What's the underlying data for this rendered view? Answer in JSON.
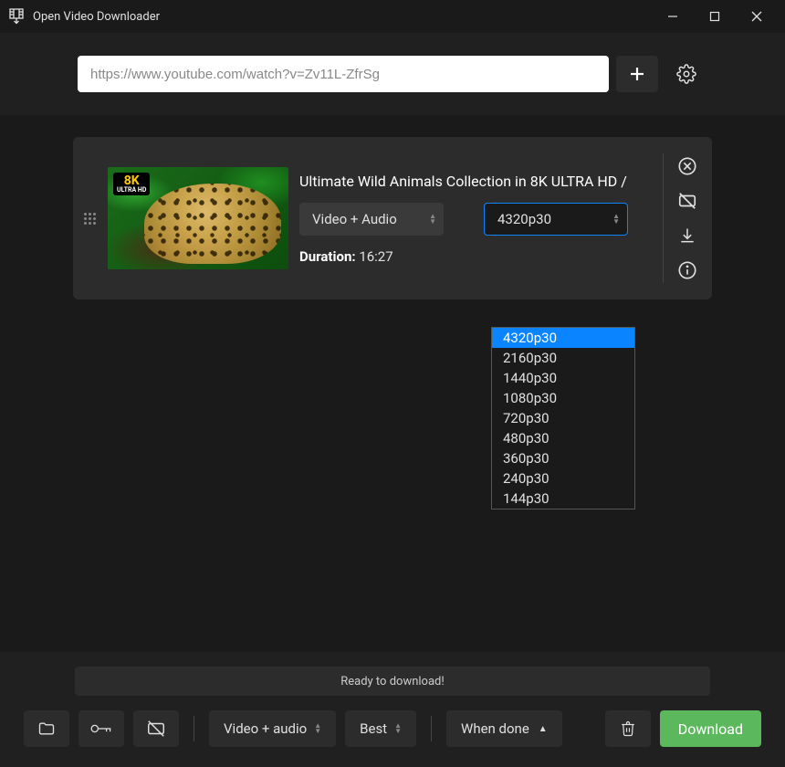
{
  "window": {
    "title": "Open Video Downloader"
  },
  "url_input": {
    "value": "https://www.youtube.com/watch?v=Zv11L-ZfrSg"
  },
  "video": {
    "title": "Ultimate Wild Animals Collection in 8K ULTRA HD /",
    "duration_label": "Duration:",
    "duration_value": "16:27",
    "thumb_badge": "8K",
    "thumb_badge_sub": "ULTRA HD",
    "mode_selected": "Video + Audio",
    "quality_selected": "4320p30",
    "quality_options": [
      "4320p30",
      "2160p30",
      "1440p30",
      "1080p30",
      "720p30",
      "480p30",
      "360p30",
      "240p30",
      "144p30"
    ]
  },
  "status": "Ready to download!",
  "toolbar": {
    "format": "Video + audio",
    "quality": "Best",
    "when_done": "When done",
    "download": "Download"
  }
}
